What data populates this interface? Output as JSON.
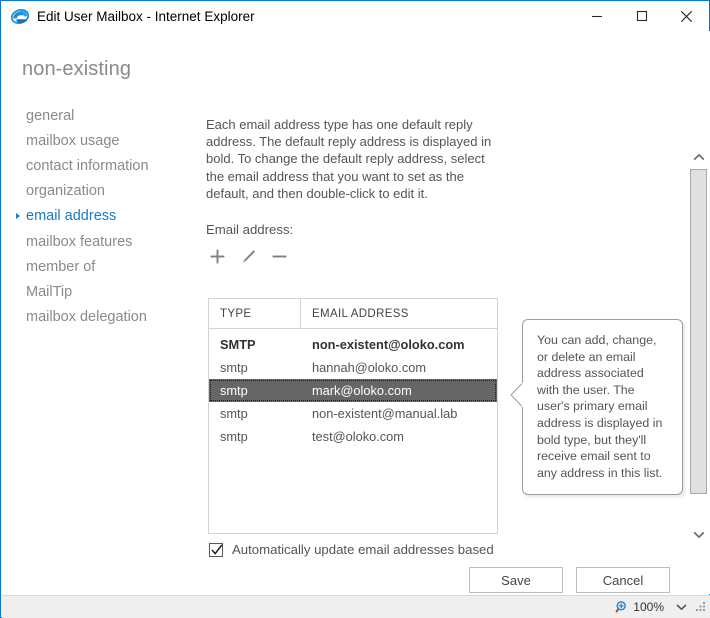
{
  "window": {
    "title": "Edit User Mailbox - Internet Explorer",
    "app_icon": "internet-explorer-icon",
    "minimize_label": "Minimize",
    "maximize_label": "Maximize",
    "close_label": "Close",
    "accent_color": "#0078d7"
  },
  "page": {
    "title": "non-existing"
  },
  "nav": {
    "items": [
      {
        "label": "general",
        "selected": false
      },
      {
        "label": "mailbox usage",
        "selected": false
      },
      {
        "label": "contact information",
        "selected": false
      },
      {
        "label": "organization",
        "selected": false
      },
      {
        "label": "email address",
        "selected": true
      },
      {
        "label": "mailbox features",
        "selected": false
      },
      {
        "label": "member of",
        "selected": false
      },
      {
        "label": "MailTip",
        "selected": false
      },
      {
        "label": "mailbox delegation",
        "selected": false
      }
    ],
    "selected_color": "#1a7bc4",
    "idle_color": "#8a8a8a"
  },
  "content": {
    "description": "Each email address type has one default reply address. The default reply address is displayed in bold. To change the default reply address, select the email address that you want to set as the default, and then double-click to edit it.",
    "field_label": "Email address:",
    "toolbar": {
      "add_label": "Add",
      "edit_label": "Edit",
      "remove_label": "Remove"
    }
  },
  "table": {
    "columns": [
      "TYPE",
      "EMAIL ADDRESS"
    ],
    "rows": [
      {
        "type": "SMTP",
        "address": "non-existent@oloko.com",
        "primary": true,
        "selected": false
      },
      {
        "type": "smtp",
        "address": "hannah@oloko.com",
        "primary": false,
        "selected": false
      },
      {
        "type": "smtp",
        "address": "mark@oloko.com",
        "primary": false,
        "selected": true
      },
      {
        "type": "smtp",
        "address": "non-existent@manual.lab",
        "primary": false,
        "selected": false
      },
      {
        "type": "smtp",
        "address": "test@oloko.com",
        "primary": false,
        "selected": false
      }
    ],
    "selected_background": "#666666"
  },
  "callout": {
    "text": "You can add, change, or delete an email address associated with the user. The user's primary email address is displayed in bold type, but they'll receive email sent to any address in this list."
  },
  "checkbox": {
    "label": "Automatically update email addresses based",
    "checked": true
  },
  "buttons": {
    "save": "Save",
    "cancel": "Cancel"
  },
  "statusbar": {
    "zoom_level": "100%",
    "zoom_icon": "zoom-magnifier-icon",
    "dropdown_icon": "chevron-down-icon"
  }
}
